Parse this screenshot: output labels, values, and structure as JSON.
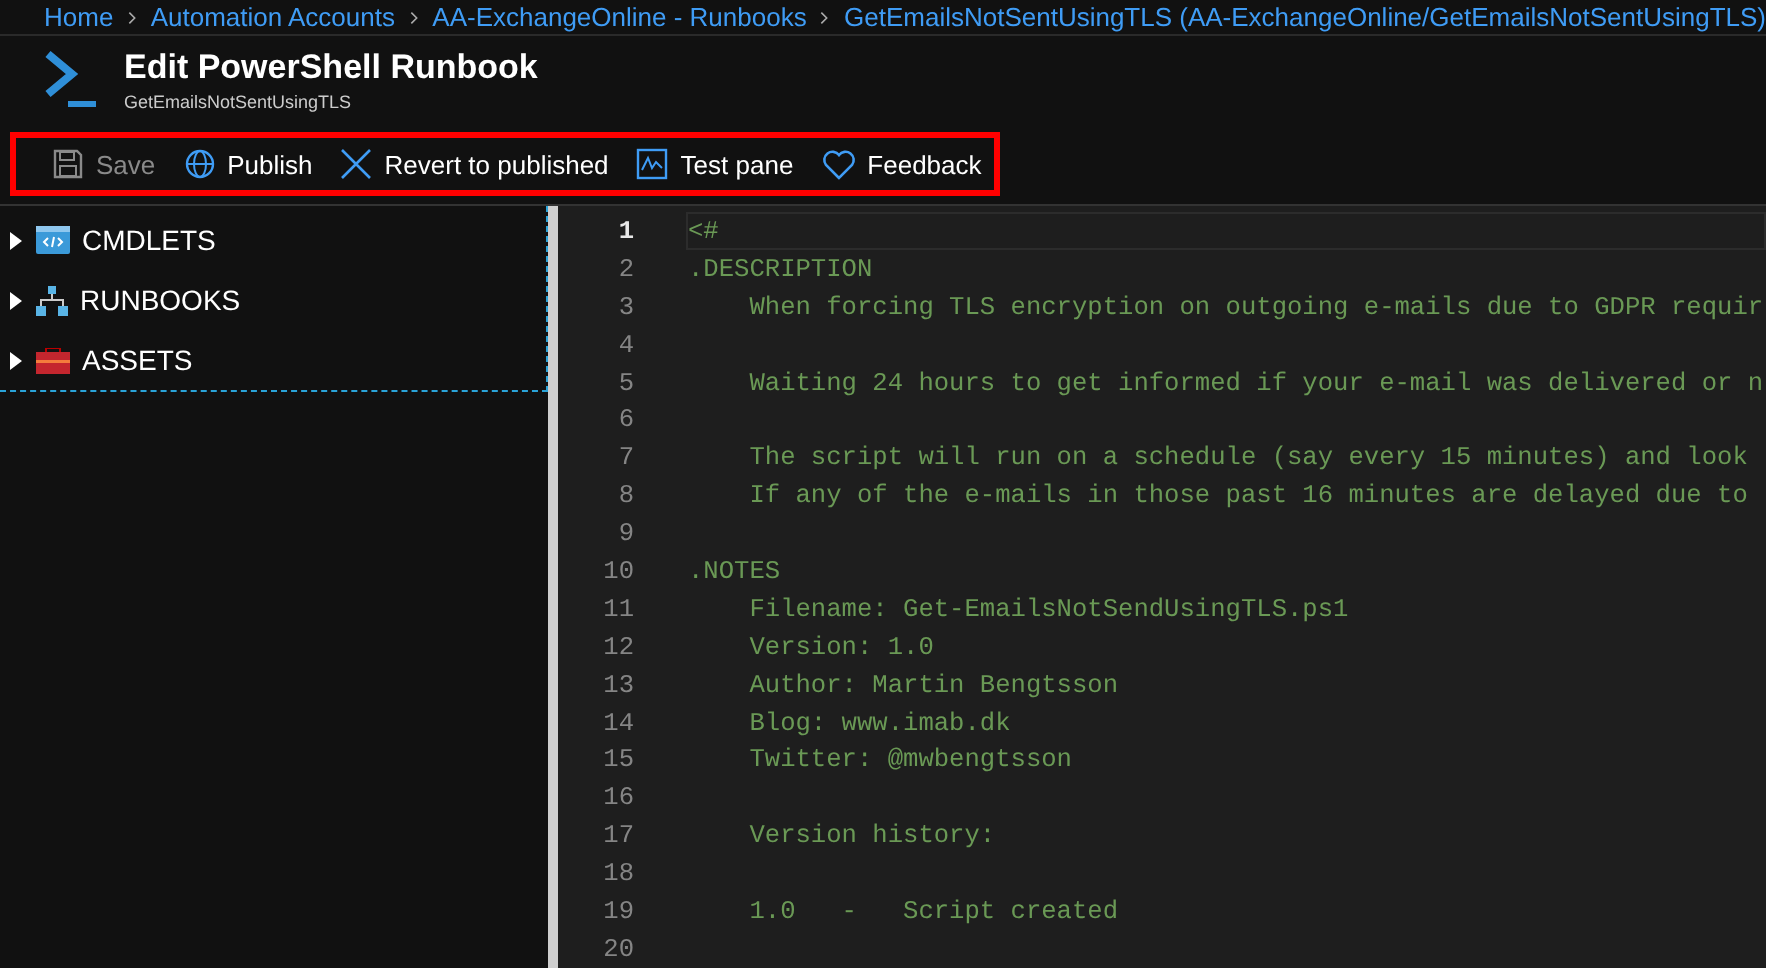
{
  "breadcrumb": [
    "Home",
    "Automation Accounts",
    "AA-ExchangeOnline - Runbooks",
    "GetEmailsNotSentUsingTLS (AA-ExchangeOnline/GetEmailsNotSentUsingTLS)"
  ],
  "header": {
    "title": "Edit PowerShell Runbook",
    "subtitle": "GetEmailsNotSentUsingTLS"
  },
  "toolbar": [
    {
      "kind": "save",
      "label": "Save",
      "disabled": true
    },
    {
      "kind": "publish",
      "label": "Publish",
      "disabled": false
    },
    {
      "kind": "revert",
      "label": "Revert to published",
      "disabled": false
    },
    {
      "kind": "test",
      "label": "Test pane",
      "disabled": false
    },
    {
      "kind": "feedback",
      "label": "Feedback",
      "disabled": false
    }
  ],
  "tree": [
    {
      "kind": "cmdlets",
      "label": "CMDLETS",
      "expanded": false
    },
    {
      "kind": "runbooks",
      "label": "RUNBOOKS",
      "expanded": false
    },
    {
      "kind": "assets",
      "label": "ASSETS",
      "expanded": false
    }
  ],
  "editor": {
    "lines": [
      {
        "number": "1",
        "text": "<#",
        "current": true
      },
      {
        "number": "2",
        "text": ".DESCRIPTION",
        "current": false
      },
      {
        "number": "3",
        "text": "    When forcing TLS encryption on outgoing e-mails due to GDPR requir",
        "current": false
      },
      {
        "number": "4",
        "current": false
      },
      {
        "number": "5",
        "text": "    Waiting 24 hours to get informed if your e-mail was delivered or n",
        "current": false
      },
      {
        "number": "6",
        "current": false
      },
      {
        "number": "7",
        "text": "    The script will run on a schedule (say every 15 minutes) and look",
        "current": false
      },
      {
        "number": "8",
        "text": "    If any of the e-mails in those past 16 minutes are delayed due to",
        "current": false
      },
      {
        "number": "9",
        "current": false
      },
      {
        "number": "10",
        "text": ".NOTES",
        "current": false
      },
      {
        "number": "11",
        "text": "    Filename: Get-EmailsNotSendUsingTLS.ps1",
        "current": false
      },
      {
        "number": "12",
        "text": "    Version: 1.0",
        "current": false
      },
      {
        "number": "13",
        "text": "    Author: Martin Bengtsson",
        "current": false
      },
      {
        "number": "14",
        "text": "    Blog: www.imab.dk",
        "current": false
      },
      {
        "number": "15",
        "text": "    Twitter: @mwbengtsson",
        "current": false
      },
      {
        "number": "16",
        "current": false
      },
      {
        "number": "17",
        "text": "    Version history:",
        "current": false
      },
      {
        "number": "18",
        "current": false
      },
      {
        "number": "19",
        "text": "    1.0   -   Script created",
        "current": false
      },
      {
        "number": "20",
        "current": false
      }
    ]
  }
}
